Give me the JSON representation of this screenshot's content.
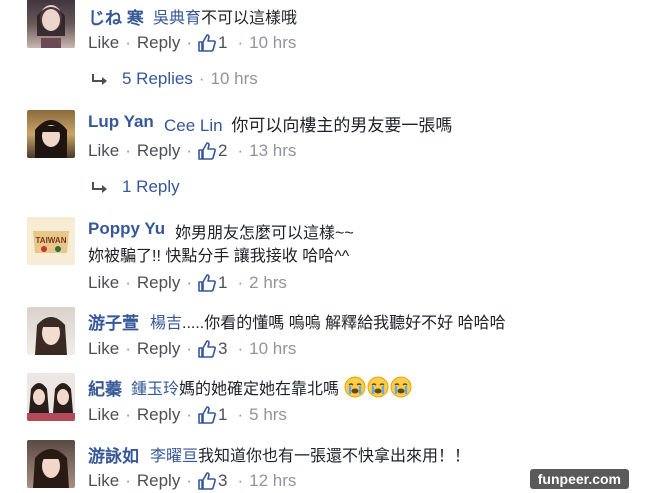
{
  "comments": [
    {
      "name": "じね 寒",
      "tag": "吳典育",
      "text": "不可以這樣哦",
      "text2": "",
      "like_label": "Like",
      "reply_label": "Reply",
      "likes": "1",
      "time": "10 hrs",
      "replies_label": "5 Replies",
      "replies_time": "10 hrs"
    },
    {
      "name": "Lup Yan",
      "tag": "Cee Lin",
      "text": "你可以向樓主的男友要一張嗎",
      "text2": "",
      "like_label": "Like",
      "reply_label": "Reply",
      "likes": "2",
      "time": "13 hrs",
      "replies_label": "1 Reply",
      "replies_time": ""
    },
    {
      "name": "Poppy Yu",
      "tag": "",
      "text": "妳男朋友怎麼可以這樣~~",
      "text2": "妳被騙了!! 快點分手 讓我接收 哈哈^^",
      "like_label": "Like",
      "reply_label": "Reply",
      "likes": "1",
      "time": "2 hrs",
      "replies_label": "",
      "replies_time": ""
    },
    {
      "name": "游子萱",
      "tag": "楊吉",
      "text": ".....你看的懂嗎 嗚嗚 解釋給我聽好不好 哈哈哈",
      "text2": "",
      "like_label": "Like",
      "reply_label": "Reply",
      "likes": "3",
      "time": "10 hrs",
      "replies_label": "",
      "replies_time": ""
    },
    {
      "name": "紀蓁",
      "tag": "鍾玉玲",
      "text": "媽的她確定她在靠北嗎",
      "text2": "",
      "like_label": "Like",
      "reply_label": "Reply",
      "likes": "1",
      "time": "5 hrs",
      "replies_label": "",
      "replies_time": ""
    },
    {
      "name": "游詠如",
      "tag": "李曜亘",
      "text": "我知道你也有一張還不快拿出來用！！",
      "text2": "",
      "like_label": "Like",
      "reply_label": "Reply",
      "likes": "3",
      "time": "12 hrs",
      "replies_label": "",
      "replies_time": ""
    }
  ],
  "watermark": "funpeer.com",
  "colors": {
    "name": "#365899",
    "meta": "#90949c",
    "action": "#4b4f56"
  }
}
